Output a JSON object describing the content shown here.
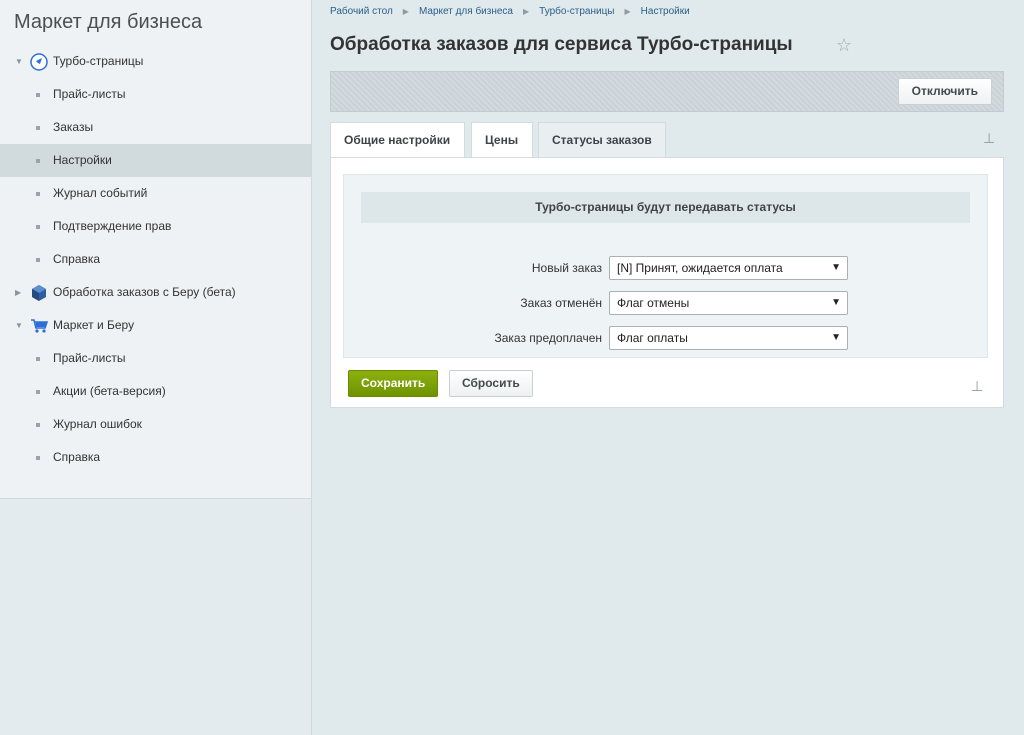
{
  "sidebar": {
    "title": "Маркет для бизнеса",
    "items": [
      {
        "label": "Турбо-страницы",
        "level": 0,
        "expanded": true,
        "icon": "rocket-icon"
      },
      {
        "label": "Прайс-листы",
        "level": 1
      },
      {
        "label": "Заказы",
        "level": 1
      },
      {
        "label": "Настройки",
        "level": 1,
        "active": true
      },
      {
        "label": "Журнал событий",
        "level": 1
      },
      {
        "label": "Подтверждение прав",
        "level": 1
      },
      {
        "label": "Справка",
        "level": 1
      },
      {
        "label": "Обработка заказов с Беру (бета)",
        "level": 0,
        "expanded": false,
        "icon": "cube-icon"
      },
      {
        "label": "Маркет и Беру",
        "level": 0,
        "expanded": true,
        "icon": "cart-icon"
      },
      {
        "label": "Прайс-листы",
        "level": 1
      },
      {
        "label": "Акции (бета-версия)",
        "level": 1
      },
      {
        "label": "Журнал ошибок",
        "level": 1
      },
      {
        "label": "Справка",
        "level": 1
      }
    ]
  },
  "breadcrumb": [
    "Рабочий стол",
    "Маркет для бизнеса",
    "Турбо-страницы",
    "Настройки"
  ],
  "page": {
    "title": "Обработка заказов для сервиса Турбо-страницы"
  },
  "toolbar": {
    "disable_label": "Отключить"
  },
  "tabs": [
    {
      "label": "Общие настройки"
    },
    {
      "label": "Цены"
    },
    {
      "label": "Статусы заказов",
      "active": true
    }
  ],
  "section": {
    "heading": "Турбо-страницы будут передавать статусы",
    "rows": [
      {
        "label": "Новый заказ",
        "value": "[N] Принят, ожидается оплата"
      },
      {
        "label": "Заказ отменён",
        "value": "Флаг отмены"
      },
      {
        "label": "Заказ предоплачен",
        "value": "Флаг оплаты"
      }
    ]
  },
  "actions": {
    "save_label": "Сохранить",
    "reset_label": "Сбросить"
  },
  "colors": {
    "accent_green": "#7aa00a",
    "link_blue": "#2b5e8a",
    "rocket_blue": "#2d6fd6"
  }
}
